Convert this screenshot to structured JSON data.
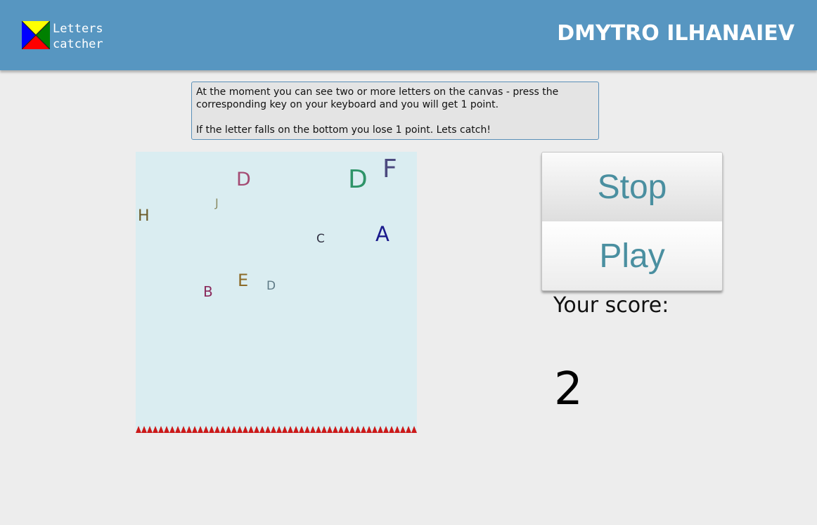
{
  "header": {
    "logo_text": "Letters\ncatcher",
    "author": "DMYTRO ILHANAIEV"
  },
  "instructions": {
    "line1": "At the moment you can see two or more letters on the canvas - press the corresponding key on your keyboard and you will get 1 point.",
    "line2": "If the letter falls on the bottom you lose 1 point. Lets catch!"
  },
  "game": {
    "letters": [
      {
        "char": "D",
        "color": "#a44b73"
      },
      {
        "char": "D",
        "color": "#2e9468"
      },
      {
        "char": "F",
        "color": "#4c4a7f"
      },
      {
        "char": "J",
        "color": "#8a8a64"
      },
      {
        "char": "H",
        "color": "#6c5c2a"
      },
      {
        "char": "C",
        "color": "#333344"
      },
      {
        "char": "A",
        "color": "#1a1a8c"
      },
      {
        "char": "E",
        "color": "#8c6a28"
      },
      {
        "char": "D",
        "color": "#5e7a86"
      },
      {
        "char": "B",
        "color": "#8a2a5c"
      }
    ],
    "spike_color": "#cc1a1a"
  },
  "controls": {
    "stop_label": "Stop",
    "play_label": "Play"
  },
  "score": {
    "label": "Your score:",
    "value": "2"
  }
}
